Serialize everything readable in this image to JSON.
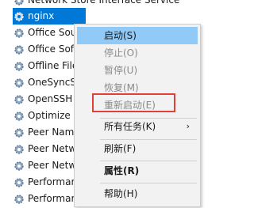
{
  "services": [
    "Network Store Interface Service",
    "nginx",
    "Office  Sou",
    "Office Soft",
    "Offline File",
    "OneSyncSv",
    "OpenSSH A",
    "Optimize d",
    "Peer Name",
    "Peer Netwo",
    "Peer Netwo",
    "Performan",
    "Performan"
  ],
  "menu": {
    "start": "启动(S)",
    "stop": "停止(O)",
    "pause": "暂停(U)",
    "resume": "恢复(M)",
    "restart": "重新启动(E)",
    "all_tasks": "所有任务(K)",
    "refresh": "刷新(F)",
    "properties": "属性(R)",
    "help": "帮助(H)"
  },
  "colors": {
    "selection": "#0078d7",
    "menu_hover": "#91c9f7",
    "annotation": "#e0403a"
  },
  "icons": {
    "service": "gear-icon",
    "submenu": "chevron-right-icon"
  }
}
